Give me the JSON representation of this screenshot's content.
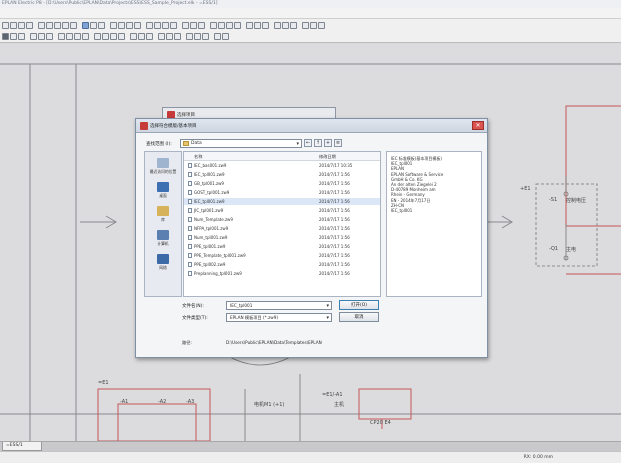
{
  "app": {
    "titlebar_text": "EPLAN Electric P8 - [D:\\Users\\Public\\EPLAN\\Data\\Projects\\ESS\\ESS_Sample_Project.elk - =ESS/1]"
  },
  "colors": {
    "canvas": "#dcdbdd",
    "wire": "#c45a5a",
    "dialog_accent": "#c63a3a",
    "selection": "#dbe7f7"
  },
  "canvas": {
    "labels": {
      "e1_left": "=E1",
      "e1_right": "+E1",
      "s1": "-S1",
      "s1_text": "控制电压",
      "q1": "-Q1",
      "q1_text": "主电",
      "bottom_e1": "=E1",
      "a1": "-A1",
      "a2": "-A2",
      "a3": "-A3",
      "center_text": "电机M1 (+1)",
      "e1_a1": "=E1/-A1",
      "e1_a1_sub": "主机",
      "small_box": "CP20 E4"
    }
  },
  "background_dialog": {
    "title": "选择项目"
  },
  "dialog": {
    "title": "选择符合模版/基本项目",
    "look_in_label": "查找范围 (I):",
    "look_in_value": "Data",
    "places": [
      {
        "label": "最近访问的位置",
        "icon": "recent-places-icon"
      },
      {
        "label": "桌面",
        "icon": "desktop-icon"
      },
      {
        "label": "库",
        "icon": "libraries-icon"
      },
      {
        "label": "计算机",
        "icon": "computer-icon"
      },
      {
        "label": "网络",
        "icon": "network-icon"
      }
    ],
    "columns": {
      "name": "名称",
      "date": "修改日期"
    },
    "files": [
      {
        "name": "IEC_bas001.zw9",
        "date": "2014/7/17 10:35",
        "selected": false
      },
      {
        "name": "IEC_tpl001.zw9",
        "date": "2014/7/17 1:56",
        "selected": false
      },
      {
        "name": "GB_tpl001.zw9",
        "date": "2014/7/17 1:56",
        "selected": false
      },
      {
        "name": "GOST_tpl001.zw9",
        "date": "2014/7/17 1:56",
        "selected": false
      },
      {
        "name": "IEC_tpl001.zw9",
        "date": "2014/7/17 1:56",
        "selected": true
      },
      {
        "name": "JIC_tpl001.zw9",
        "date": "2014/7/17 1:56",
        "selected": false
      },
      {
        "name": "Num_Template.zw9",
        "date": "2014/7/17 1:56",
        "selected": false
      },
      {
        "name": "NFPA_tpl001.zw9",
        "date": "2014/7/17 1:56",
        "selected": false
      },
      {
        "name": "Num_tpl001.zw9",
        "date": "2014/7/17 1:56",
        "selected": false
      },
      {
        "name": "PPE_tpl001.zw9",
        "date": "2014/7/17 1:56",
        "selected": false
      },
      {
        "name": "PPE_Template_tpl001.zw9",
        "date": "2014/7/17 1:56",
        "selected": false
      },
      {
        "name": "PPE_tpl002.zw9",
        "date": "2014/7/17 1:56",
        "selected": false
      },
      {
        "name": "Preplanning_tpl001.zw9",
        "date": "2014/7/17 1:56",
        "selected": false
      }
    ],
    "preview_lines": [
      "IEC 标准模板(基本项目模板)",
      "IEC_tpl001",
      "EPLAN",
      "EPLAN Software & Service",
      "GmbH & Co. KG",
      "An der alten Ziegelei 2",
      "D-40789 Monheim am",
      "Rhein - Germany",
      "EN - 2014年7月17日",
      "ZH-CN",
      "IEC_tpl001"
    ],
    "filename_label": "文件名(N):",
    "filename_value": "IEC_tpl001",
    "filetype_label": "文件类型(T):",
    "filetype_value": "EPLAN 模板项目 (*.zw9)",
    "open_button": "打开(O)",
    "cancel_button": "取消",
    "path_label": "路径:",
    "path_value": "D:\\Users\\Public\\EPLAN\\Data\\Templates\\EPLAN"
  },
  "bottom_tab": {
    "label": "=ESS/1"
  },
  "status": {
    "text": "RX: 0.00 mm"
  }
}
